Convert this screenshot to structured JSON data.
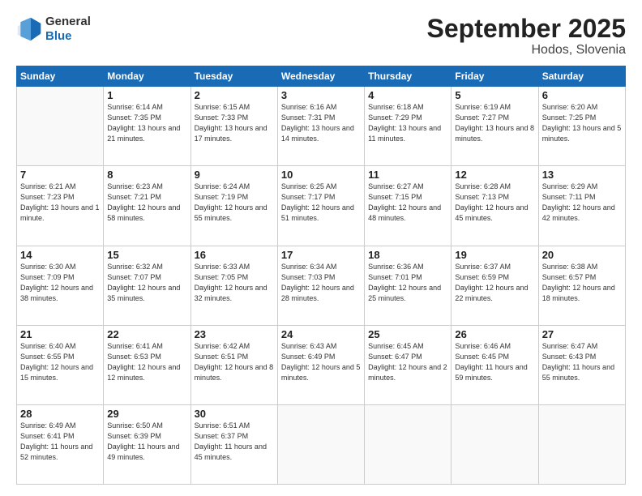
{
  "header": {
    "logo_general": "General",
    "logo_blue": "Blue",
    "title": "September 2025",
    "subtitle": "Hodos, Slovenia"
  },
  "weekdays": [
    "Sunday",
    "Monday",
    "Tuesday",
    "Wednesday",
    "Thursday",
    "Friday",
    "Saturday"
  ],
  "weeks": [
    [
      {
        "day": "",
        "info": ""
      },
      {
        "day": "1",
        "info": "Sunrise: 6:14 AM\nSunset: 7:35 PM\nDaylight: 13 hours\nand 21 minutes."
      },
      {
        "day": "2",
        "info": "Sunrise: 6:15 AM\nSunset: 7:33 PM\nDaylight: 13 hours\nand 17 minutes."
      },
      {
        "day": "3",
        "info": "Sunrise: 6:16 AM\nSunset: 7:31 PM\nDaylight: 13 hours\nand 14 minutes."
      },
      {
        "day": "4",
        "info": "Sunrise: 6:18 AM\nSunset: 7:29 PM\nDaylight: 13 hours\nand 11 minutes."
      },
      {
        "day": "5",
        "info": "Sunrise: 6:19 AM\nSunset: 7:27 PM\nDaylight: 13 hours\nand 8 minutes."
      },
      {
        "day": "6",
        "info": "Sunrise: 6:20 AM\nSunset: 7:25 PM\nDaylight: 13 hours\nand 5 minutes."
      }
    ],
    [
      {
        "day": "7",
        "info": "Sunrise: 6:21 AM\nSunset: 7:23 PM\nDaylight: 13 hours\nand 1 minute."
      },
      {
        "day": "8",
        "info": "Sunrise: 6:23 AM\nSunset: 7:21 PM\nDaylight: 12 hours\nand 58 minutes."
      },
      {
        "day": "9",
        "info": "Sunrise: 6:24 AM\nSunset: 7:19 PM\nDaylight: 12 hours\nand 55 minutes."
      },
      {
        "day": "10",
        "info": "Sunrise: 6:25 AM\nSunset: 7:17 PM\nDaylight: 12 hours\nand 51 minutes."
      },
      {
        "day": "11",
        "info": "Sunrise: 6:27 AM\nSunset: 7:15 PM\nDaylight: 12 hours\nand 48 minutes."
      },
      {
        "day": "12",
        "info": "Sunrise: 6:28 AM\nSunset: 7:13 PM\nDaylight: 12 hours\nand 45 minutes."
      },
      {
        "day": "13",
        "info": "Sunrise: 6:29 AM\nSunset: 7:11 PM\nDaylight: 12 hours\nand 42 minutes."
      }
    ],
    [
      {
        "day": "14",
        "info": "Sunrise: 6:30 AM\nSunset: 7:09 PM\nDaylight: 12 hours\nand 38 minutes."
      },
      {
        "day": "15",
        "info": "Sunrise: 6:32 AM\nSunset: 7:07 PM\nDaylight: 12 hours\nand 35 minutes."
      },
      {
        "day": "16",
        "info": "Sunrise: 6:33 AM\nSunset: 7:05 PM\nDaylight: 12 hours\nand 32 minutes."
      },
      {
        "day": "17",
        "info": "Sunrise: 6:34 AM\nSunset: 7:03 PM\nDaylight: 12 hours\nand 28 minutes."
      },
      {
        "day": "18",
        "info": "Sunrise: 6:36 AM\nSunset: 7:01 PM\nDaylight: 12 hours\nand 25 minutes."
      },
      {
        "day": "19",
        "info": "Sunrise: 6:37 AM\nSunset: 6:59 PM\nDaylight: 12 hours\nand 22 minutes."
      },
      {
        "day": "20",
        "info": "Sunrise: 6:38 AM\nSunset: 6:57 PM\nDaylight: 12 hours\nand 18 minutes."
      }
    ],
    [
      {
        "day": "21",
        "info": "Sunrise: 6:40 AM\nSunset: 6:55 PM\nDaylight: 12 hours\nand 15 minutes."
      },
      {
        "day": "22",
        "info": "Sunrise: 6:41 AM\nSunset: 6:53 PM\nDaylight: 12 hours\nand 12 minutes."
      },
      {
        "day": "23",
        "info": "Sunrise: 6:42 AM\nSunset: 6:51 PM\nDaylight: 12 hours\nand 8 minutes."
      },
      {
        "day": "24",
        "info": "Sunrise: 6:43 AM\nSunset: 6:49 PM\nDaylight: 12 hours\nand 5 minutes."
      },
      {
        "day": "25",
        "info": "Sunrise: 6:45 AM\nSunset: 6:47 PM\nDaylight: 12 hours\nand 2 minutes."
      },
      {
        "day": "26",
        "info": "Sunrise: 6:46 AM\nSunset: 6:45 PM\nDaylight: 11 hours\nand 59 minutes."
      },
      {
        "day": "27",
        "info": "Sunrise: 6:47 AM\nSunset: 6:43 PM\nDaylight: 11 hours\nand 55 minutes."
      }
    ],
    [
      {
        "day": "28",
        "info": "Sunrise: 6:49 AM\nSunset: 6:41 PM\nDaylight: 11 hours\nand 52 minutes."
      },
      {
        "day": "29",
        "info": "Sunrise: 6:50 AM\nSunset: 6:39 PM\nDaylight: 11 hours\nand 49 minutes."
      },
      {
        "day": "30",
        "info": "Sunrise: 6:51 AM\nSunset: 6:37 PM\nDaylight: 11 hours\nand 45 minutes."
      },
      {
        "day": "",
        "info": ""
      },
      {
        "day": "",
        "info": ""
      },
      {
        "day": "",
        "info": ""
      },
      {
        "day": "",
        "info": ""
      }
    ]
  ]
}
